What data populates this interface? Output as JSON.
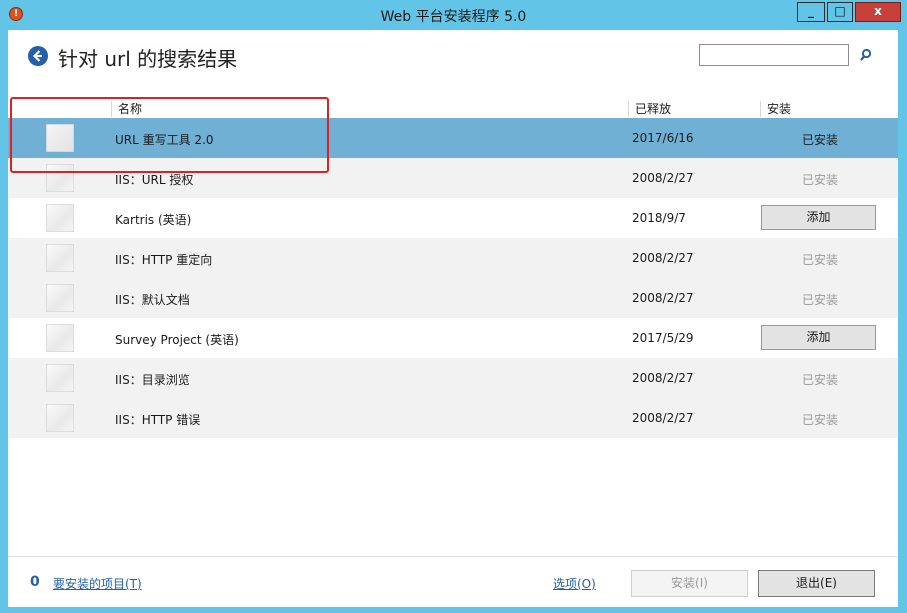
{
  "window": {
    "title": "Web 平台安装程序 5.0",
    "min_label": "_",
    "max_label": "□",
    "close_label": "x"
  },
  "header": {
    "title": "针对 url 的搜索结果",
    "search_value": ""
  },
  "table": {
    "columns": {
      "name": "名称",
      "released": "已释放",
      "install": "安装"
    },
    "rows": [
      {
        "name": "URL 重写工具 2.0",
        "date": "2017/6/16",
        "status": "已安装",
        "action": ""
      },
      {
        "name": "IIS：URL 授权",
        "date": "2008/2/27",
        "status": "已安装",
        "action": ""
      },
      {
        "name": "Kartris (英语)",
        "date": "2018/9/7",
        "status": "",
        "action": "添加"
      },
      {
        "name": "IIS：HTTP 重定向",
        "date": "2008/2/27",
        "status": "已安装",
        "action": ""
      },
      {
        "name": "IIS：默认文档",
        "date": "2008/2/27",
        "status": "已安装",
        "action": ""
      },
      {
        "name": "Survey Project (英语)",
        "date": "2017/5/29",
        "status": "",
        "action": "添加"
      },
      {
        "name": "IIS：目录浏览",
        "date": "2008/2/27",
        "status": "已安装",
        "action": ""
      },
      {
        "name": "IIS：HTTP 错误",
        "date": "2008/2/27",
        "status": "已安装",
        "action": ""
      }
    ]
  },
  "footer": {
    "count": "0",
    "items_link": "要安装的项目(T)",
    "options_link": "选项(O)",
    "install_label": "安装(I)",
    "exit_label": "退出(E)"
  },
  "colors": {
    "frame": "#62c4e6",
    "selected_row": "#70b0d4",
    "accent": "#255faa",
    "highlight": "#e02020"
  },
  "icons": {
    "app": "app-icon",
    "back": "back-arrow-icon",
    "search": "search-icon"
  }
}
